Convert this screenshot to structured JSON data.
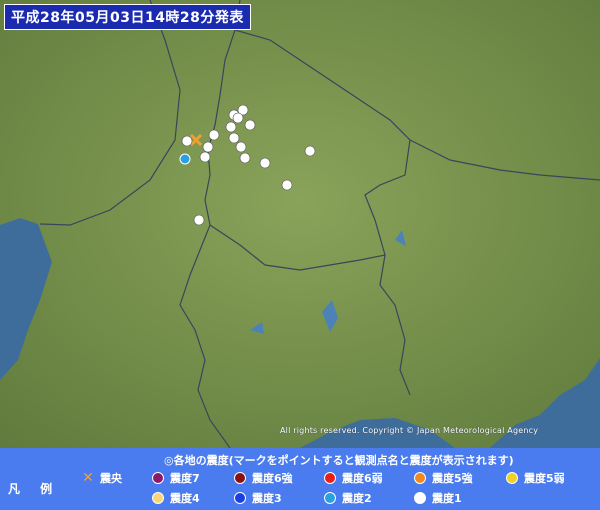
{
  "header": {
    "timestamp": "平成28年05月03日14時28分発表"
  },
  "copyright": "All rights reserved. Copyright © Japan Meteorological Agency",
  "legend": {
    "title": "◎各地の震度(マークをポイントすると観測点名と震度が表示されます)",
    "heading": "凡 例",
    "items": [
      {
        "label": "震央",
        "color": "#f0a030"
      },
      {
        "label": "震度7",
        "color": "#8b1a6b"
      },
      {
        "label": "震度6強",
        "color": "#8b1010"
      },
      {
        "label": "震度6弱",
        "color": "#e8201a"
      },
      {
        "label": "震度5強",
        "color": "#f08a20"
      },
      {
        "label": "震度5弱",
        "color": "#f0d020"
      },
      {
        "label": "震度4",
        "color": "#f5d77a"
      },
      {
        "label": "震度3",
        "color": "#1a3ee0"
      },
      {
        "label": "震度2",
        "color": "#2aa0e0"
      },
      {
        "label": "震度1",
        "color": "#ffffff"
      }
    ]
  },
  "map": {
    "land_color": "#7d9652",
    "water_color": "#3c6ea0",
    "stations_intensity1_count": 16,
    "stations_intensity2_count": 1
  }
}
